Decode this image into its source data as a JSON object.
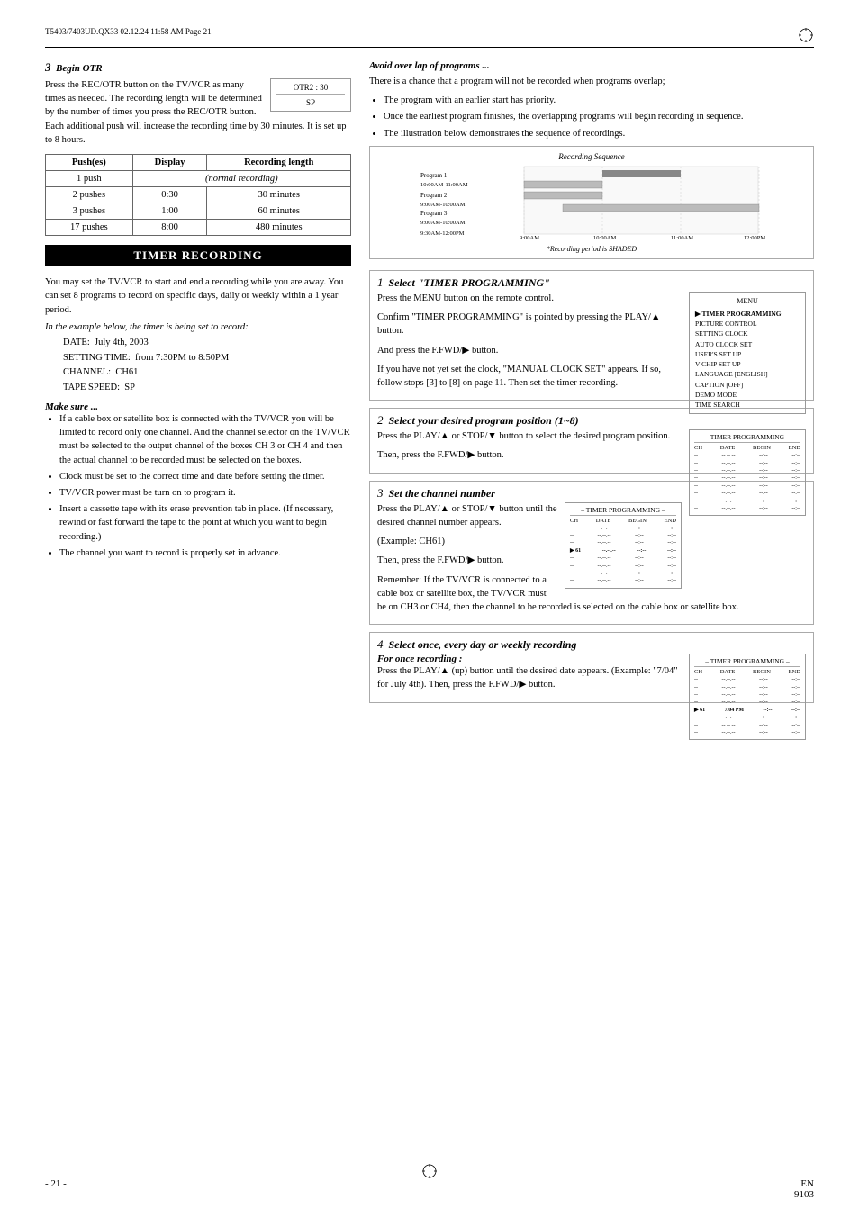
{
  "header": {
    "left": "T5403/7403UD.QX33  02.12.24  11:58 AM  Page 21",
    "crosshair": true
  },
  "left_col": {
    "otr_section": {
      "step": "3",
      "title": "Begin OTR",
      "body1": "Press the REC/OTR button on the TV/VCR as many times as needed. The recording length will be determined by the number of times you press the REC/OTR button. Each additional push will increase the recording time by 30 minutes. It is set up to 8 hours.",
      "display": {
        "top": "OTR2 : 30",
        "bottom": "SP"
      },
      "table": {
        "headers": [
          "Push(es)",
          "Display",
          "Recording length"
        ],
        "rows": [
          {
            "pushes": "1 push",
            "display": "",
            "length": "(normal recording)",
            "span": true
          },
          {
            "pushes": "2 pushes",
            "display": "0:30",
            "length": "30 minutes"
          },
          {
            "pushes": "3 pushes",
            "display": "1:00",
            "length": "60 minutes"
          },
          {
            "pushes": "17 pushes",
            "display": "8:00",
            "length": "480 minutes"
          }
        ]
      }
    },
    "timer_recording": {
      "header": "TIMER RECORDING",
      "body1": "You may set the TV/VCR to start and end a recording while you are away. You can set 8 programs to record on specific days, daily or weekly within a 1 year period.",
      "example_intro": "In the example below, the timer is being set to record:",
      "example": {
        "date_label": "DATE:",
        "date_val": "July 4th, 2003",
        "setting_label": "SETTING TIME:",
        "setting_val": "from 7:30PM to 8:50PM",
        "channel_label": "CHANNEL:",
        "channel_val": "CH61",
        "tape_label": "TAPE SPEED:",
        "tape_val": "SP"
      },
      "make_sure_title": "Make sure ...",
      "bullets": [
        "If a cable box or satellite box is connected with the TV/VCR you will be limited to record only one channel.  And the channel selector on the TV/VCR must be selected to the output channel of the boxes CH 3 or CH 4 and then the actual channel to be recorded must be selected on the boxes.",
        "Clock must be set to the correct time and date before setting the timer.",
        "TV/VCR power must be turn on to program it.",
        "Insert a cassette tape with its erase prevention tab in place. (If necessary, rewind or fast forward the tape to the point at which you want to begin recording.)",
        "The channel you want to record is properly set in advance."
      ]
    }
  },
  "right_col": {
    "avoid_overlap": {
      "title": "Avoid over lap of programs ...",
      "body": "There is a chance that a program will not be recorded when programs overlap;",
      "bullets": [
        "The program with an earlier start has priority.",
        "Once the earliest program finishes, the overlapping programs will begin recording in sequence.",
        "The illustration below demonstrates the sequence of recordings."
      ],
      "chart": {
        "title": "Recording Sequence",
        "programs": [
          {
            "name": "Program 1",
            "time": "10:00AM-11:00AM"
          },
          {
            "name": "Program 2",
            "time": "9:00AM-10:00AM"
          },
          {
            "name": "Program 3",
            "time": "9:00AM-10:00AM"
          },
          {
            "name": "",
            "time": "9:30AM-12:00PM"
          }
        ],
        "times": [
          "9:00AM",
          "10:00AM",
          "11:00AM",
          "12:00PM"
        ],
        "note": "*Recording period is SHADED"
      }
    },
    "steps": [
      {
        "number": "1",
        "title": "Select \"TIMER PROGRAMMING\"",
        "body": "Press the MENU button on the remote control.",
        "body2": "Confirm \"TIMER PROGRAMMING\" is pointed by pressing the PLAY/▲ button.",
        "body3": "And press the F.FWD/▶ button.",
        "note": "If you have not yet set the clock, \"MANUAL CLOCK SET\" appears. If so, follow stops [3] to [8] on page 11. Then set the timer recording.",
        "menu": {
          "title": "– MENU –",
          "items": [
            {
              "text": "TIMER PROGRAMMING",
              "selected": true
            },
            {
              "text": "PICTURE CONTROL"
            },
            {
              "text": "SETTING CLOCK"
            },
            {
              "text": "AUTO CLOCK SET"
            },
            {
              "text": "USER'S SET UP"
            },
            {
              "text": "V CHIP SET UP"
            },
            {
              "text": "LANGUAGE  [ENGLISH]"
            },
            {
              "text": "CAPTION [OFF]"
            },
            {
              "text": "DEMO MODE"
            },
            {
              "text": "TIME SEARCH"
            }
          ]
        }
      },
      {
        "number": "2",
        "title": "Select your desired program position (1~8)",
        "body": "Press the PLAY/▲ or STOP/▼ button to select the desired program position.",
        "body2": "Then, press the F.FWD/▶ button.",
        "display_type": "timer_prog"
      },
      {
        "number": "3",
        "title": "Set the channel number",
        "body": "Press the PLAY/▲ or STOP/▼ button until the desired channel number appears.",
        "body2": "(Example: CH61)",
        "body3": "Then, press the F.FWD/▶ button.",
        "note2": "Remember: If the TV/VCR is connected to a cable box or satellite box, the TV/VCR must be on CH3 or CH4, then the channel to be recorded is selected on the cable box or satellite box.",
        "display_type": "timer_prog2"
      },
      {
        "number": "4",
        "title": "Select once, every day or weekly recording",
        "for_once": "For once recording :",
        "body": "Press the PLAY/▲ (up) button until the desired date appears. (Example: \"7/04\" for July 4th). Then, press the F.FWD/▶ button.",
        "display_type": "timer_prog3"
      }
    ]
  },
  "footer": {
    "page": "- 21 -",
    "lang": "EN",
    "model": "9103"
  }
}
